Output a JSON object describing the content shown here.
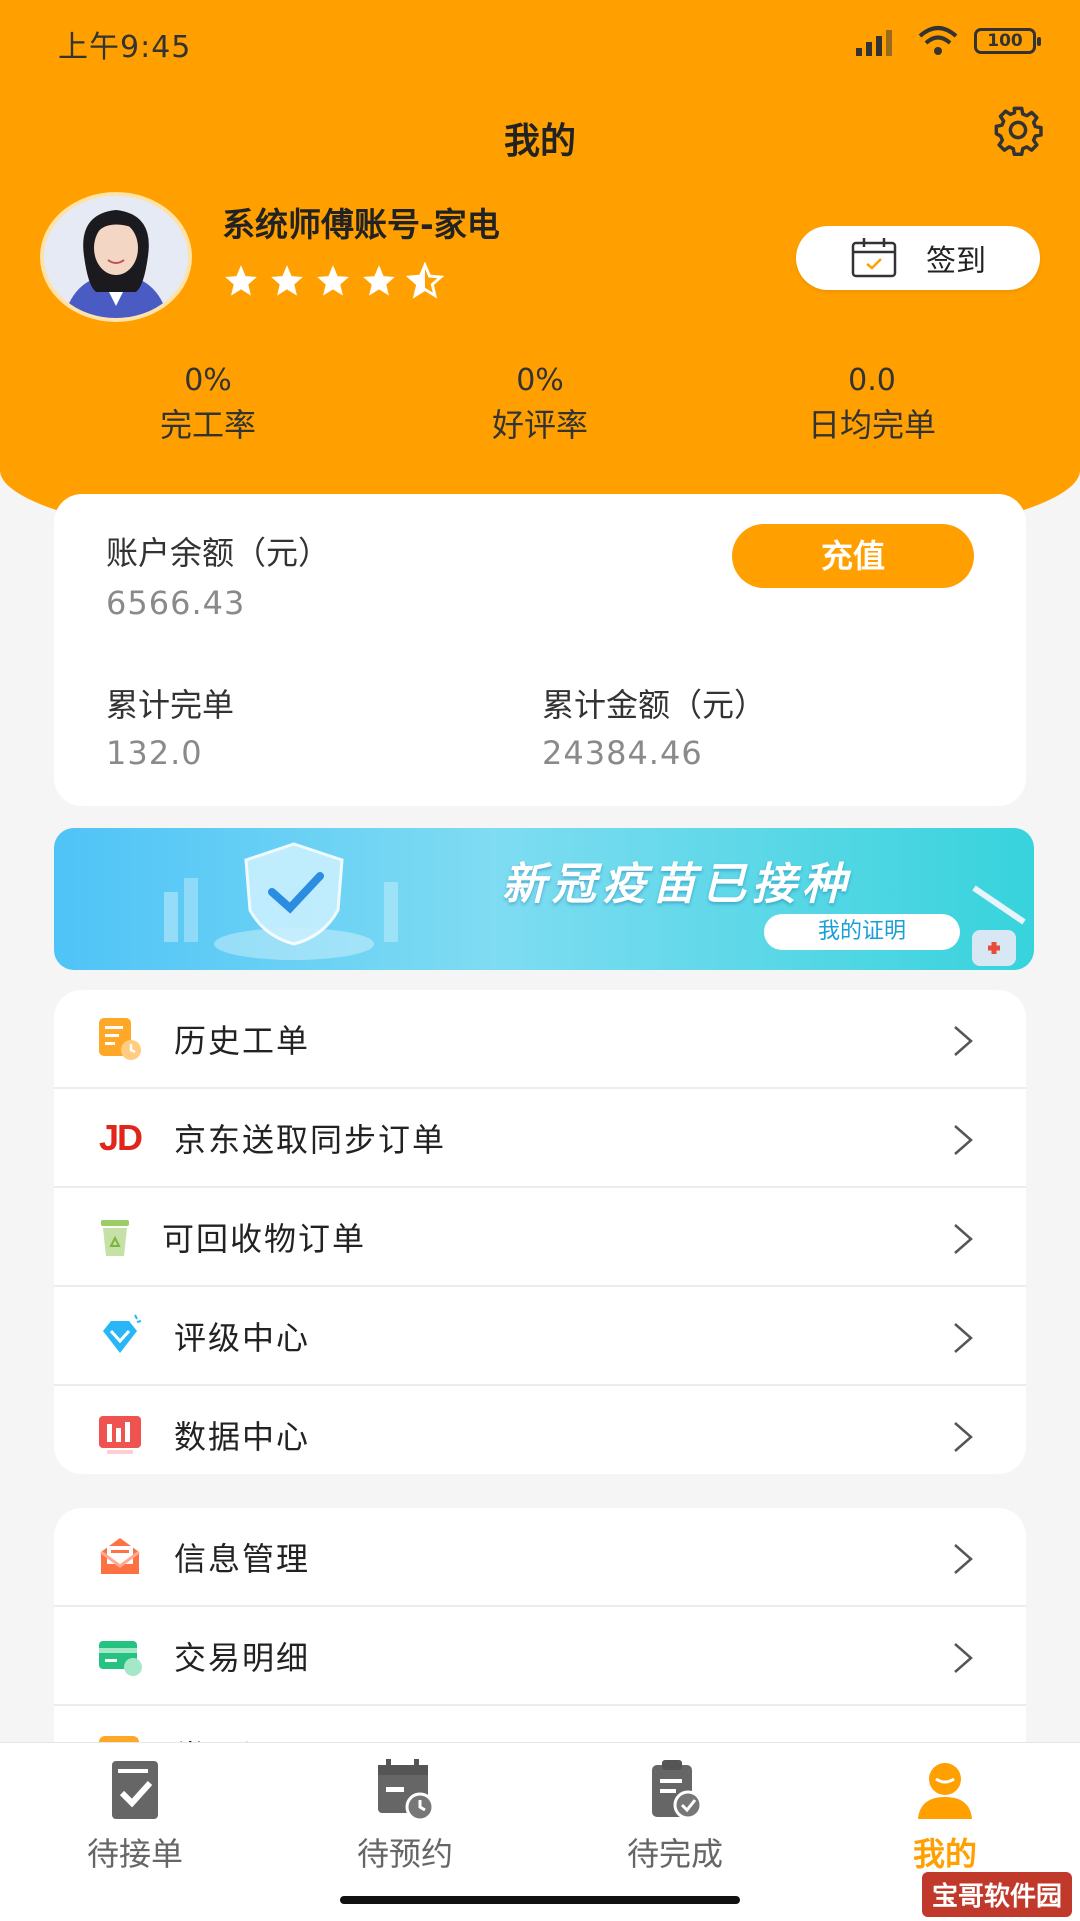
{
  "status": {
    "time": "上午9:45",
    "battery": "100"
  },
  "header": {
    "title": "我的"
  },
  "profile": {
    "name": "系统师傅账号-家电",
    "rating_stars": 4.5,
    "checkin_label": "签到"
  },
  "stats": [
    {
      "value": "0%",
      "label": "完工率"
    },
    {
      "value": "0%",
      "label": "好评率"
    },
    {
      "value": "0.0",
      "label": "日均完单"
    }
  ],
  "balance": {
    "label": "账户余额（元）",
    "value": "6566.43",
    "recharge_label": "充值",
    "orders_label": "累计完单",
    "orders_value": "132.0",
    "amount_label": "累计金额（元）",
    "amount_value": "24384.46"
  },
  "banner": {
    "title": "新冠疫苗已接种",
    "button": "我的证明"
  },
  "menu1": [
    {
      "label": "历史工单",
      "icon": "history-order-icon"
    },
    {
      "label": "京东送取同步订单",
      "icon": "jd-icon"
    },
    {
      "label": "可回收物订单",
      "icon": "recycle-bin-icon"
    },
    {
      "label": "评级中心",
      "icon": "diamond-icon"
    },
    {
      "label": "数据中心",
      "icon": "data-chart-icon"
    }
  ],
  "menu2": [
    {
      "label": "信息管理",
      "icon": "mail-icon"
    },
    {
      "label": "交易明细",
      "icon": "card-icon"
    },
    {
      "label": "常见问题",
      "icon": "question-icon"
    }
  ],
  "tabs": [
    {
      "label": "待接单",
      "icon": "pending-accept-icon"
    },
    {
      "label": "待预约",
      "icon": "pending-schedule-icon"
    },
    {
      "label": "待完成",
      "icon": "pending-complete-icon"
    },
    {
      "label": "我的",
      "icon": "profile-icon"
    }
  ],
  "colors": {
    "accent": "#ffa000",
    "background": "#f5f5f5"
  },
  "watermark": "宝哥软件园"
}
